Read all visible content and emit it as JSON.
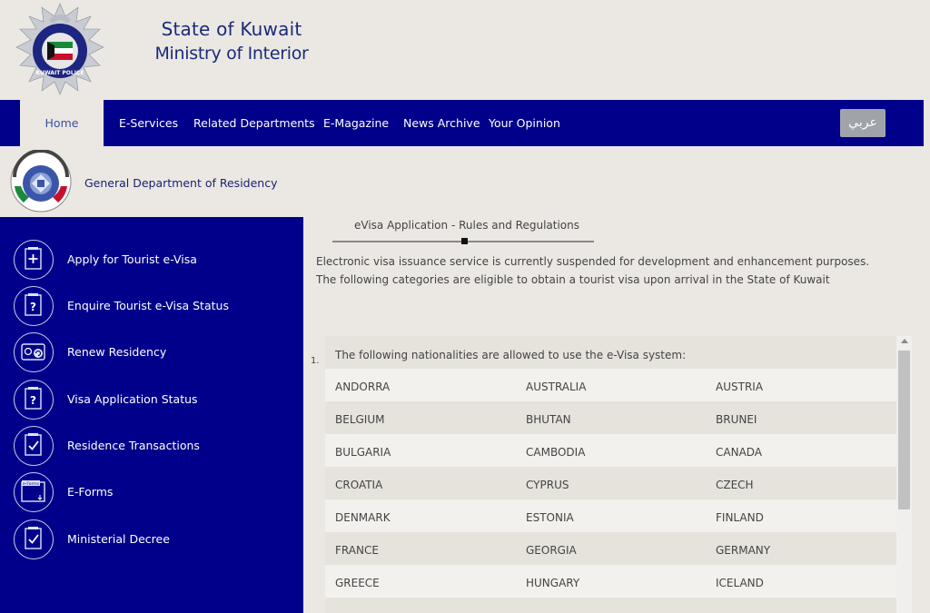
{
  "header": {
    "title_line1": "State of Kuwait",
    "title_line2": "Ministry of Interior",
    "logo_text": "KUWAIT POLICE"
  },
  "nav": {
    "items": [
      "Home",
      "E-Services",
      "Related Departments",
      "E-Magazine",
      "News Archive",
      "Your Opinion"
    ],
    "active": "Home",
    "lang_button": "عربي"
  },
  "department": {
    "title": "General Department of Residency"
  },
  "sidebar": {
    "items": [
      {
        "label": "Apply for Tourist e-Visa",
        "icon": "form-plus-icon"
      },
      {
        "label": "Enquire Tourist e-Visa Status",
        "icon": "form-question-icon"
      },
      {
        "label": "Renew Residency",
        "icon": "id-card-renew-icon"
      },
      {
        "label": "Visa Application Status",
        "icon": "form-question-icon"
      },
      {
        "label": "Residence Transactions",
        "icon": "form-check-icon"
      },
      {
        "label": "E-Forms",
        "icon": "e-forms-icon",
        "badge": "e-Forms"
      },
      {
        "label": "Ministerial Decree",
        "icon": "form-check-icon"
      }
    ]
  },
  "main": {
    "section_title": "eVisa Application - Rules and Regulations",
    "notice": "Electronic visa issuance service is currently suspended for development and enhancement purposes. The following categories are eligible to obtain a tourist visa upon arrival in the State of Kuwait",
    "list_number": "1.",
    "table_header": "The following nationalities are allowed to use the e-Visa system:",
    "rows": [
      [
        "ANDORRA",
        "AUSTRALIA",
        "AUSTRIA"
      ],
      [
        "BELGIUM",
        "BHUTAN",
        "BRUNEI"
      ],
      [
        "BULGARIA",
        "CAMBODIA",
        "CANADA"
      ],
      [
        "CROATIA",
        "CYPRUS",
        "CZECH"
      ],
      [
        "DENMARK",
        "ESTONIA",
        "FINLAND"
      ],
      [
        "FRANCE",
        "GEORGIA",
        "GERMANY"
      ],
      [
        "GREECE",
        "HUNGARY",
        "ICELAND"
      ]
    ]
  },
  "colors": {
    "nav_bg": "#00008b",
    "page_bg": "#ebe8e3",
    "title_text": "#1a2a7a"
  }
}
